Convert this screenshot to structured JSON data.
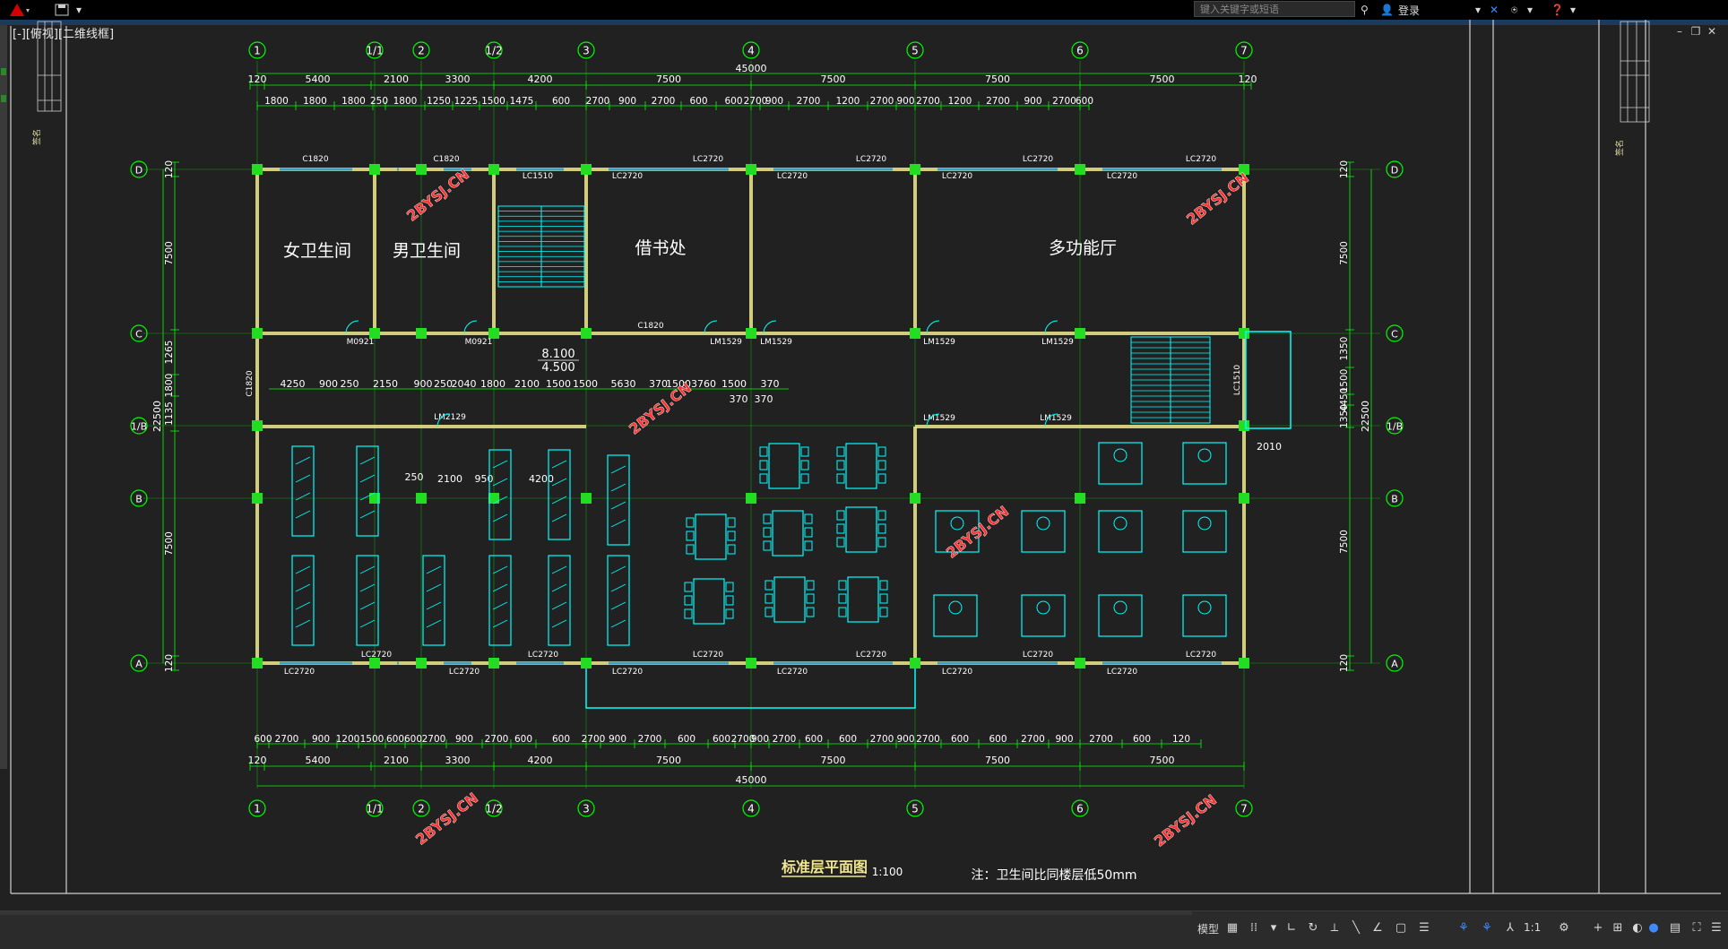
{
  "titlebar": {
    "search_placeholder": "键入关键字或短语",
    "login_label": "登录"
  },
  "view_label": "[-][俯视][二维线框]",
  "drawing": {
    "axes_top": [
      "1",
      "1/1",
      "2",
      "1/2",
      "3",
      "4",
      "5",
      "6",
      "7"
    ],
    "axes_left": [
      "D",
      "C",
      "1/B",
      "B",
      "A"
    ],
    "dims_top_total": "45000",
    "dims_top_main": [
      "120",
      "5400",
      "2100",
      "3300",
      "4200",
      "7500",
      "7500",
      "7500",
      "7500",
      "120"
    ],
    "dims_top_detail": [
      "1800",
      "1800",
      "1800",
      "250",
      "1800",
      "1250",
      "1225",
      "1500",
      "1475",
      "600",
      "2700",
      "900",
      "2700",
      "600",
      "600",
      "2700",
      "900",
      "2700",
      "1200",
      "2700",
      "900",
      "2700",
      "1200",
      "2700",
      "900",
      "2700",
      "600"
    ],
    "dims_bottom_detail": [
      "600",
      "2700",
      "900",
      "1200",
      "1500",
      "600",
      "600",
      "2700",
      "900",
      "2700",
      "600",
      "600",
      "2700",
      "900",
      "2700",
      "600",
      "600",
      "2700",
      "900",
      "2700",
      "600",
      "600",
      "2700",
      "900",
      "2700",
      "600",
      "600",
      "2700",
      "900",
      "2700",
      "600",
      "120"
    ],
    "dims_bottom_main": [
      "120",
      "5400",
      "2100",
      "3300",
      "4200",
      "7500",
      "7500",
      "7500",
      "7500"
    ],
    "dims_bottom_total": "45000",
    "dims_left": [
      "120",
      "7500",
      "1265",
      "1800",
      "1135",
      "7500",
      "120"
    ],
    "dims_left_total": "22500",
    "dims_right": [
      "120",
      "7500",
      "1350",
      "1500",
      "4450",
      "1350",
      "7500",
      "120"
    ],
    "dims_right_total": "22500",
    "dim_2010": "2010",
    "corridor_dims": [
      "4250",
      "900",
      "250",
      "2150",
      "900",
      "250",
      "2040",
      "1800",
      "2100",
      "1500",
      "1500",
      "5630",
      "370",
      "1500",
      "3760",
      "1500",
      "370"
    ],
    "corridor_dims_2": [
      "370",
      "370"
    ],
    "stack_dims": [
      "250",
      "2100",
      "950",
      "4200"
    ],
    "level_1": "8.100",
    "level_2": "4.500",
    "rooms": {
      "womens_wc": "女卫生间",
      "mens_wc": "男卫生间",
      "loan_desk": "借书处",
      "multipurpose": "多功能厅"
    },
    "tags_top": [
      "C1820",
      "C1820",
      "LC1510",
      "LC2720",
      "LC2720",
      "LC2720",
      "LC2720",
      "LC2720",
      "LC2720",
      "LC2720",
      "LC2720"
    ],
    "tags_corridor": [
      "M0921",
      "M0921",
      "C1820",
      "LM1529",
      "LM1529",
      "LM1529",
      "LM1529"
    ],
    "tags_mid": [
      "LM2129",
      "LM1529",
      "LM1529",
      "C1820",
      "LC1510"
    ],
    "tags_bottom": [
      "LC2720",
      "LC2720",
      "LC2720",
      "LC2720",
      "LC2720",
      "LC2720",
      "LC2720",
      "LC2720",
      "LC2720",
      "LC2720",
      "LC2720",
      "LC2720"
    ],
    "watermark": "2BYSJ.CN",
    "title": "标准层平面图",
    "scale": "1:100",
    "note": "注：卫生间比同楼层低50mm"
  },
  "statusbar": {
    "model_label": "模型",
    "scale_label": "1:1"
  },
  "colors": {
    "background": "#212121",
    "axis": "#00ff00",
    "wall": "#f0e68c",
    "furniture": "#00ffff",
    "column": "#00ff00",
    "watermark": "#ff3030"
  }
}
